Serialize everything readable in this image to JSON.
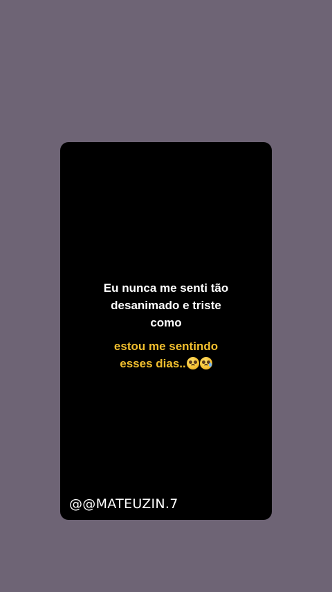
{
  "story": {
    "line1": "Eu nunca me senti tão",
    "line2": "desanimado e triste",
    "line3": "como",
    "line4": "estou me sentindo",
    "line5": "esses dias..",
    "emojis": [
      "pleading-face-icon",
      "sad-relieved-face-icon"
    ],
    "handle": "@@MATEUZIN.7",
    "colors": {
      "background": "#6e6475",
      "card": "#000000",
      "white_text": "#ffffff",
      "accent_text": "#f2bf2e"
    }
  }
}
